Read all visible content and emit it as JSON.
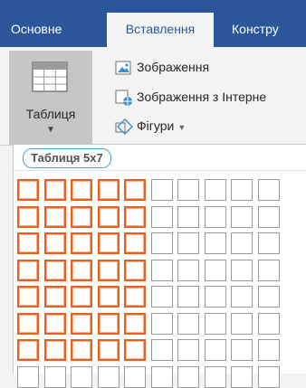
{
  "tabs": [
    {
      "label": "Основне",
      "active": false
    },
    {
      "label": "Вставлення",
      "active": true
    },
    {
      "label": "Констру",
      "active": false
    }
  ],
  "ribbon": {
    "table_button": {
      "label": "Таблиця",
      "caret": "▼",
      "icon": "table-icon"
    },
    "items": [
      {
        "label": "Зображення",
        "icon": "picture-icon",
        "has_dropdown": false
      },
      {
        "label": "Зображення з Інтерне",
        "icon": "online-picture-icon",
        "has_dropdown": false
      },
      {
        "label": "Фігури",
        "icon": "shapes-icon",
        "has_dropdown": true,
        "caret": "▼"
      }
    ]
  },
  "table_picker": {
    "title": "Таблиця 5x7",
    "selected_cols": 5,
    "selected_rows": 7,
    "grid_cols": 10,
    "grid_rows": 8
  },
  "colors": {
    "tab_bar": "#2b579a",
    "selection": "#e8601f",
    "title_outline": "#4fa3d6"
  }
}
